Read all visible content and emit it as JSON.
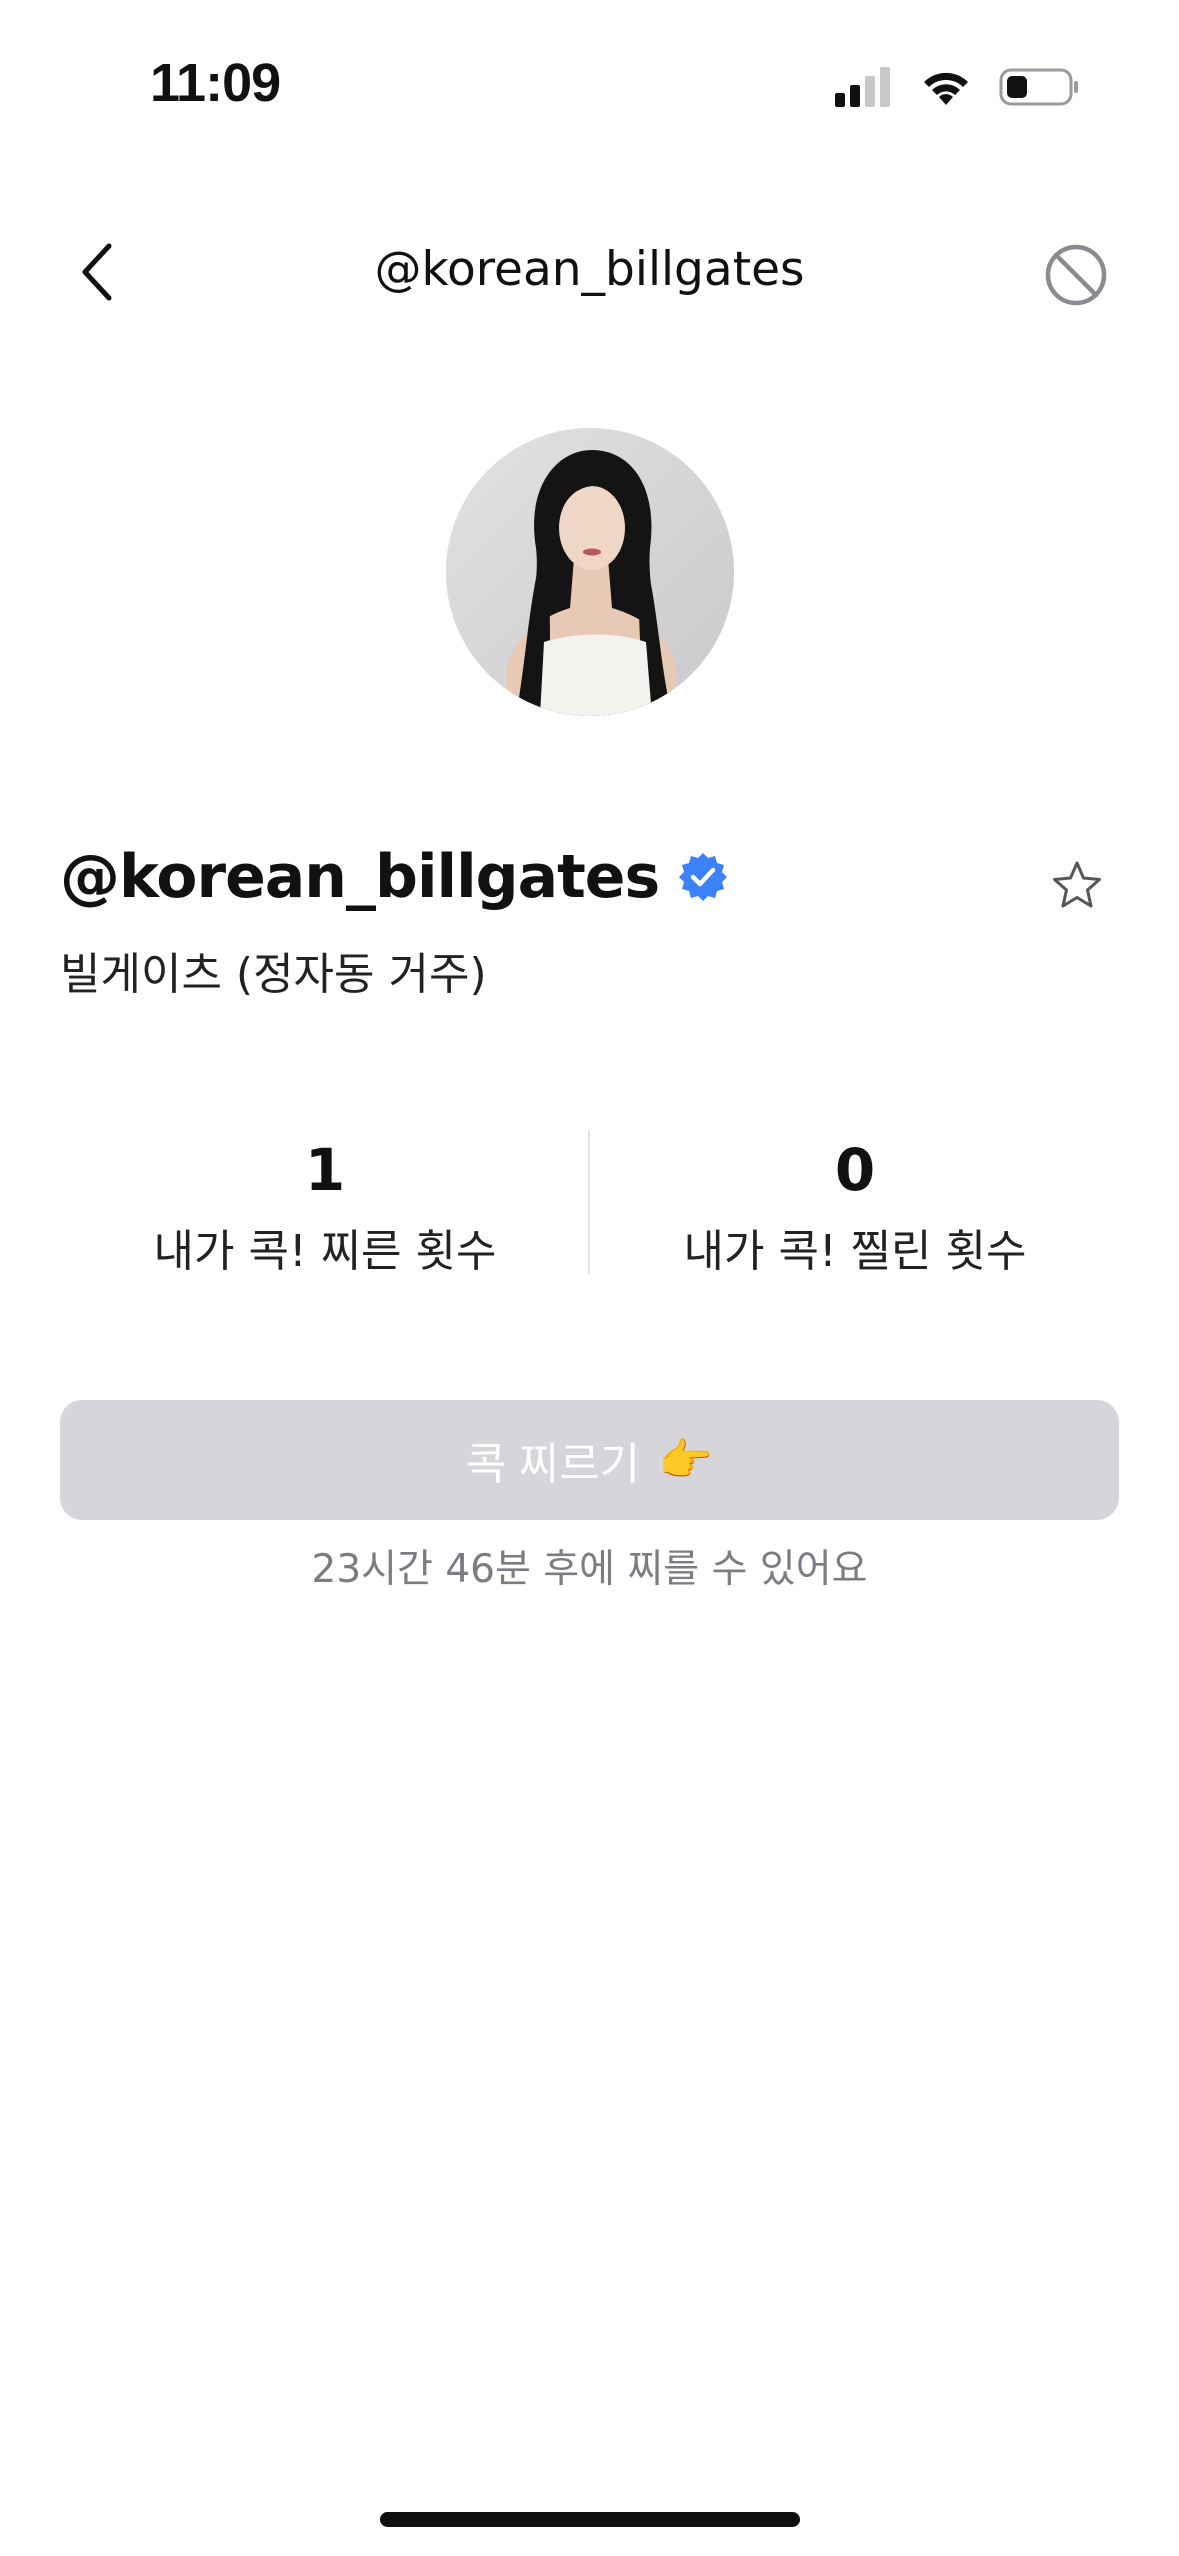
{
  "status_bar": {
    "time": "11:09"
  },
  "nav": {
    "title": "@korean_billgates"
  },
  "profile": {
    "handle": "@korean_billgates",
    "verified": true,
    "bio": "빌게이츠 (정자동 거주)",
    "favorited": false
  },
  "stats": [
    {
      "value": "1",
      "label": "내가 콕! 찌른 횟수"
    },
    {
      "value": "0",
      "label": "내가 콕! 찔린 횟수"
    }
  ],
  "poke": {
    "button_label": "콕 찌르기",
    "button_emoji": "👉",
    "disabled": true,
    "cooldown_text": "23시간 46분 후에 찌를 수 있어요"
  },
  "colors": {
    "verified_badge": "#3b82f6",
    "button_disabled_bg": "#d5d5da",
    "muted_text": "#7c7c84"
  }
}
